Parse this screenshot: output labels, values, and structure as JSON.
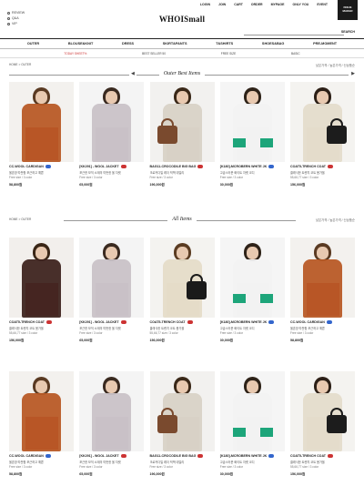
{
  "header": {
    "left_links": [
      "REVIEW",
      "Q&A",
      "VIP"
    ],
    "logo": "WHOISmall",
    "top_menu": [
      "LOGIN",
      "JOIN",
      "CART",
      "ORDER",
      "MYPAGE",
      "ONLY YOU",
      "EVENT"
    ],
    "badge_line1": "ISSUE",
    "badge_line2": "MAKER",
    "search_label": "SEARCH"
  },
  "nav": {
    "main": [
      "OUTER",
      "BLOUSE&KNIT",
      "DRESS",
      "SKIRT&PANTS",
      "T&SHIRTS",
      "SHOES&BAG",
      "PRE-MOMENT"
    ],
    "sub": [
      "TODAY SHEET%",
      "BEST SELLER 50",
      "FREE SIZE",
      "BASIC"
    ],
    "sub_active_color": "#cc3333"
  },
  "section1": {
    "breadcrumb": "HOME > OUTER",
    "right_text": "낮은가격 / 높은가격 / 신상품순",
    "title": "Outer Best Items",
    "prev_arrow": "◀",
    "next_arrow": "▶"
  },
  "section2": {
    "breadcrumb": "HOME > OUTER",
    "right_text": "낮은가격 / 높은가격 / 신상품순",
    "title": "All Items"
  },
  "rows": [
    {
      "products": [
        {
          "name": "CC-WOOL CARDIGAN",
          "desc": "울혼방 따뜻함 포근하고 예쁜",
          "size": "Free size / 3 color",
          "price": "58,800원",
          "tag_color": "#3366cc",
          "style": "cardigan"
        },
        {
          "name": "[KK291] - WOOL JACKET",
          "desc": "포근한 모직 소재의 따뜻한 울 자켓",
          "size": "Free size / 3 color",
          "price": "65,000원",
          "tag_color": "#cc3333",
          "style": "greycoat"
        },
        {
          "name": "BAG11-CROCODILE BIG BAG",
          "desc": "크로커다일 레더 빅백 데일리",
          "size": "Free size / 3 color",
          "price": "196,000원",
          "tag_color": "#cc3333",
          "style": "brownbag"
        },
        {
          "name": "[K180]-MCROBERN WHITE JK",
          "desc": "고급스러운 화이트 자켓 코디",
          "size": "Free size / 3 color",
          "price": "30,000원",
          "tag_color": "#3366cc",
          "style": "whitejk"
        },
        {
          "name": "COAT5-TRENCH COAT",
          "desc": "클래식한 트렌치 코트 봄가을",
          "size": "55,66,77 size / 3 color",
          "price": "156,000원",
          "tag_color": "#cc3333",
          "style": "trench"
        }
      ]
    },
    {
      "products": [
        {
          "name": "COAT5-TRENCH COAT",
          "desc": "클래식한 트렌치 코트 봄가을",
          "size": "55,66,77 size / 3 color",
          "price": "156,000원",
          "tag_color": "#cc3333",
          "style": "darkcoat"
        },
        {
          "name": "[KK291] - WOOL JACKET",
          "desc": "포근한 모직 소재의 따뜻한 울 자켓",
          "size": "Free size / 3 color",
          "price": "65,000원",
          "tag_color": "#cc3333",
          "style": "greycoat"
        },
        {
          "name": "COAT5-TRENCH COAT",
          "desc": "클래식한 트렌치 코트 봄가을",
          "size": "55,66,77 size / 3 color",
          "price": "156,000원",
          "tag_color": "#cc3333",
          "style": "trenchbag"
        },
        {
          "name": "[K180]-MCROBERN WHITE JK",
          "desc": "고급스러운 화이트 자켓 코디",
          "size": "Free size / 3 color",
          "price": "30,000원",
          "tag_color": "#3366cc",
          "style": "whitejk"
        },
        {
          "name": "CC-WOOL CARDIGAN",
          "desc": "울혼방 따뜻함 포근하고 예쁜",
          "size": "Free size / 3 color",
          "price": "58,800원",
          "tag_color": "#3366cc",
          "style": "cardigan"
        }
      ]
    },
    {
      "products": [
        {
          "name": "CC-WOOL CARDIGAN",
          "desc": "울혼방 따뜻함 포근하고 예쁜",
          "size": "Free size / 3 color",
          "price": "58,800원",
          "tag_color": "#3366cc",
          "style": "cardigan"
        },
        {
          "name": "[KK291] - WOOL JACKET",
          "desc": "포근한 모직 소재의 따뜻한 울 자켓",
          "size": "Free size / 3 color",
          "price": "65,000원",
          "tag_color": "#cc3333",
          "style": "greycoat"
        },
        {
          "name": "BAG11-CROCODILE BIG BAG",
          "desc": "크로커다일 레더 빅백 데일리",
          "size": "Free size / 3 color",
          "price": "196,000원",
          "tag_color": "#cc3333",
          "style": "brownbag"
        },
        {
          "name": "[K180]-MCROBERN WHITE JK",
          "desc": "고급스러운 화이트 자켓 코디",
          "size": "Free size / 3 color",
          "price": "30,000원",
          "tag_color": "#3366cc",
          "style": "whitejk"
        },
        {
          "name": "COAT5-TRENCH COAT",
          "desc": "클래식한 트렌치 코트 봄가을",
          "size": "55,66,77 size / 3 color",
          "price": "156,000원",
          "tag_color": "#cc3333",
          "style": "trench"
        }
      ]
    }
  ]
}
